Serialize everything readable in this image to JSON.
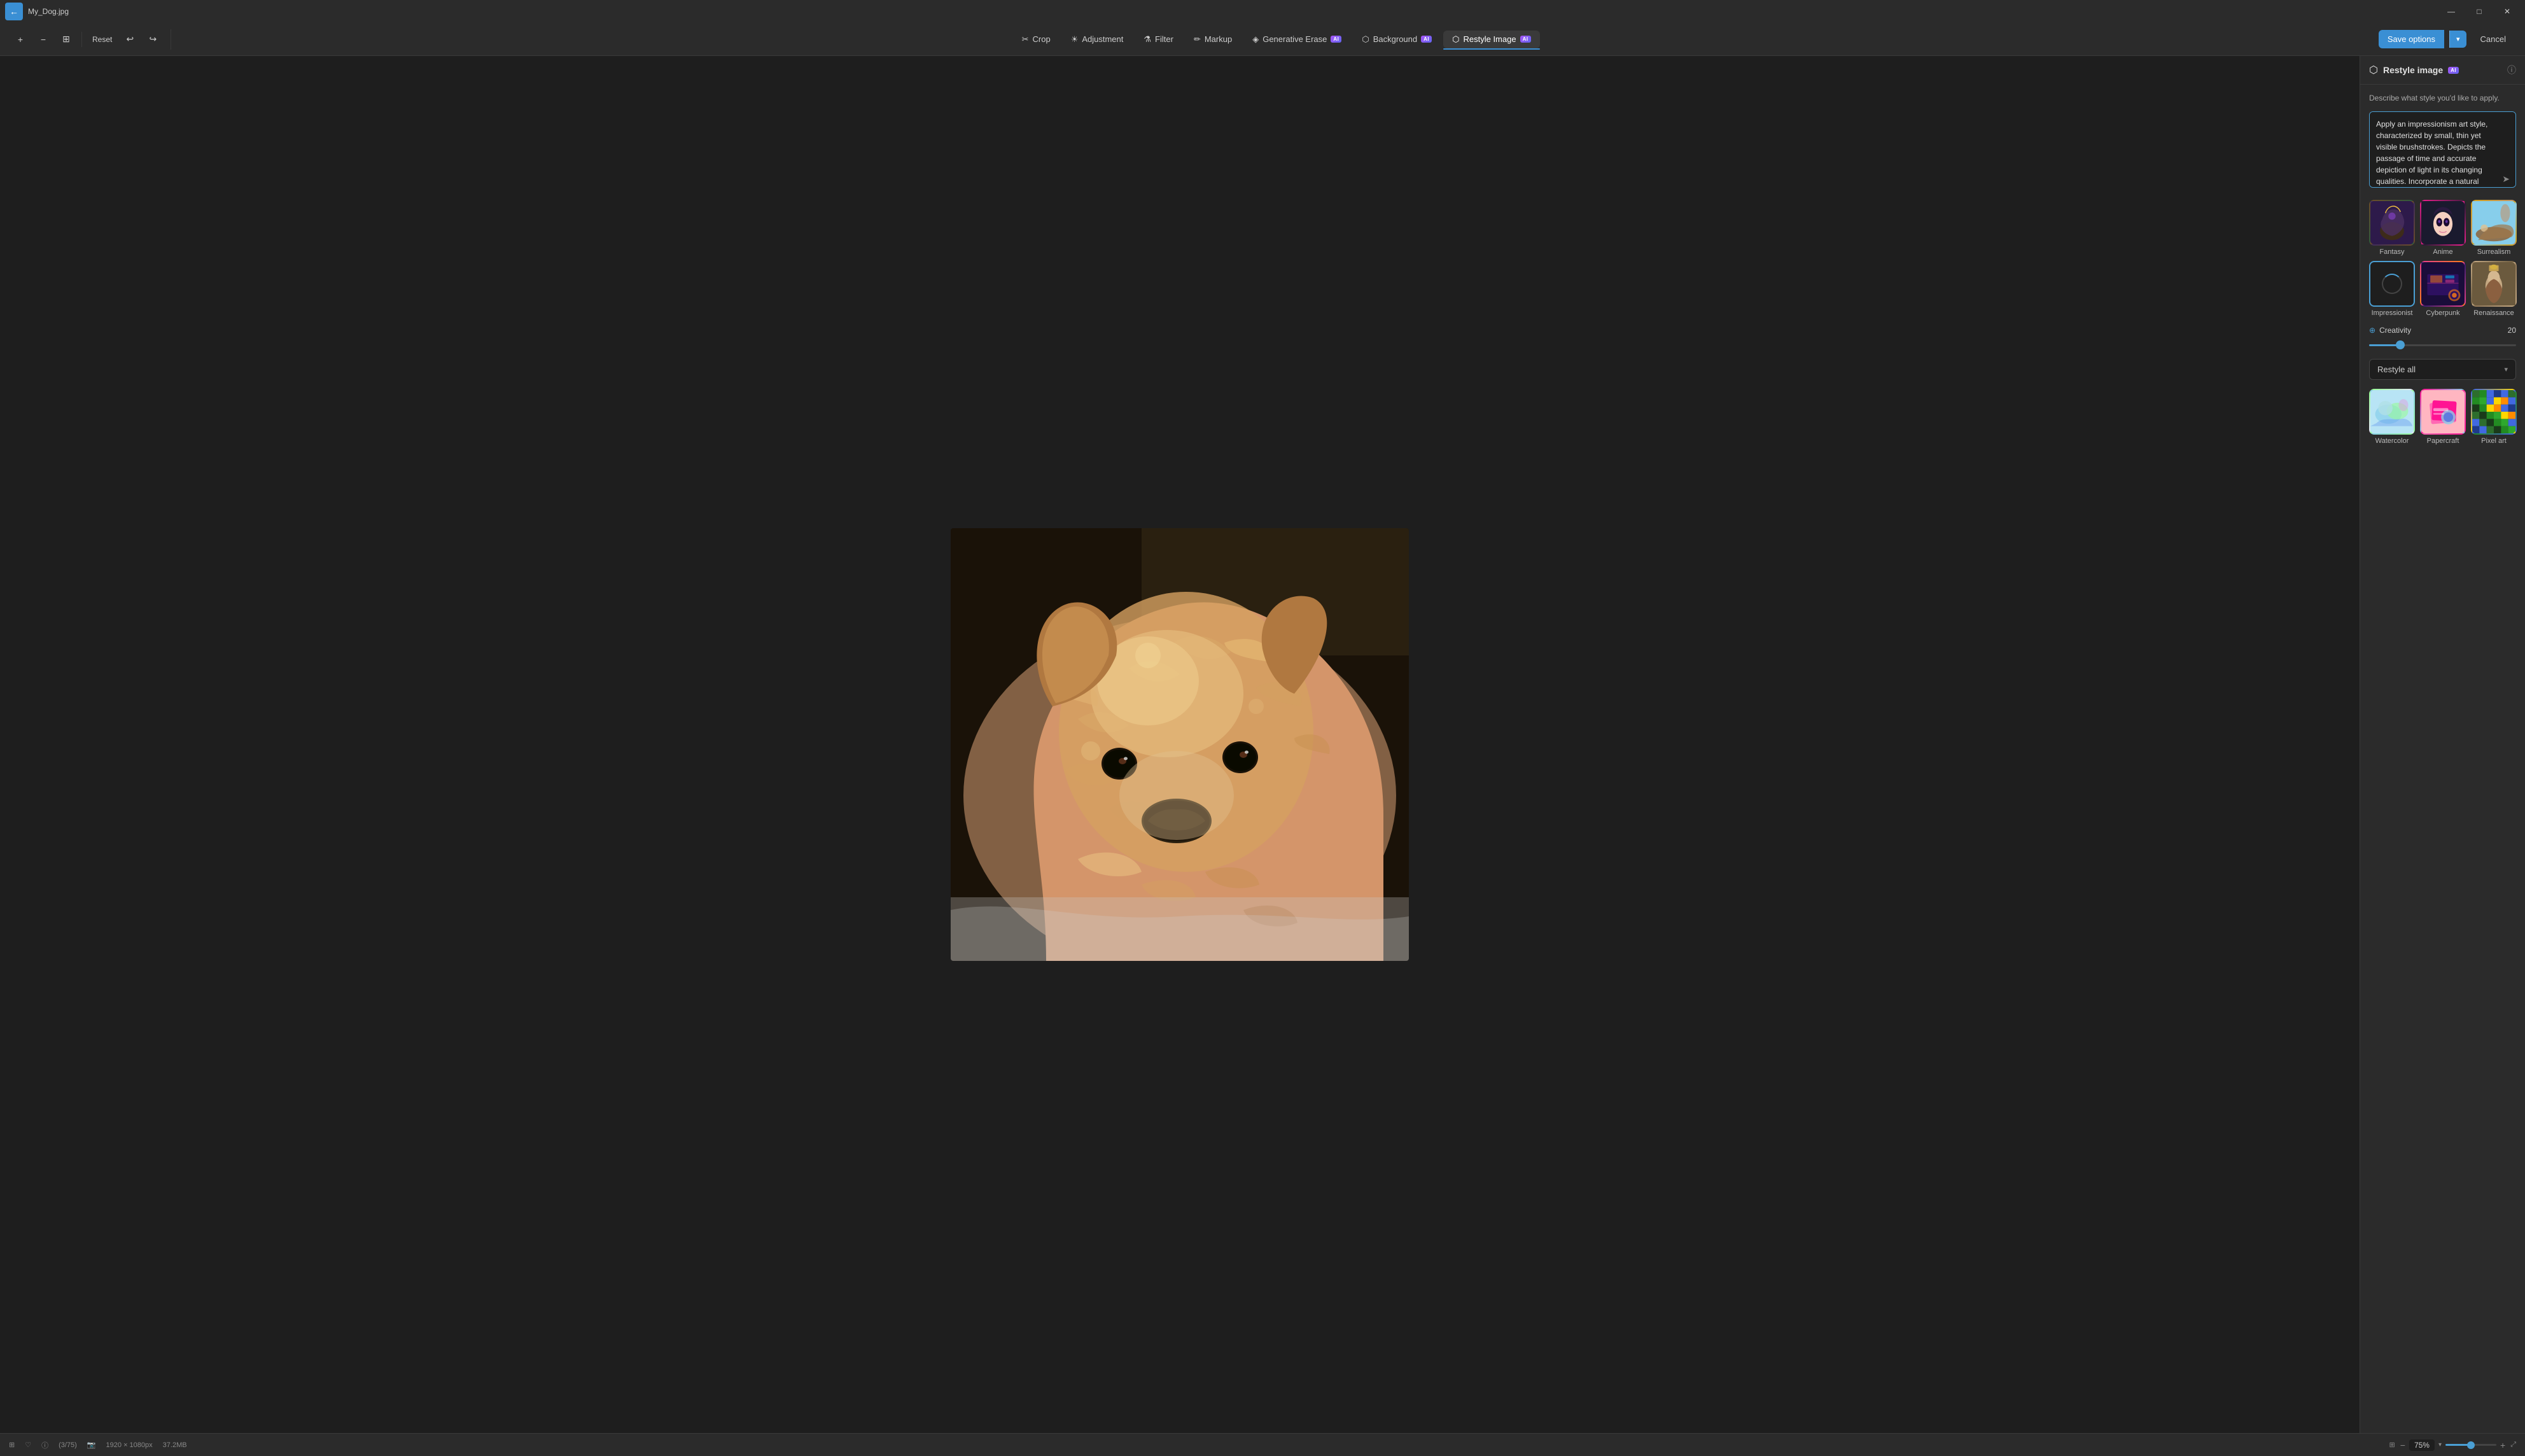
{
  "titlebar": {
    "title": "My_Dog.jpg",
    "back_icon": "←",
    "minimize": "—",
    "maximize": "□",
    "close": "✕"
  },
  "toolbar": {
    "zoom_in": "+",
    "zoom_out": "−",
    "frame": "⊞",
    "reset_label": "Reset",
    "undo": "↩",
    "redo": "↪",
    "tools": [
      {
        "id": "crop",
        "icon": "⊡",
        "label": "Crop",
        "ai": false
      },
      {
        "id": "adjustment",
        "icon": "☀",
        "label": "Adjustment",
        "ai": false
      },
      {
        "id": "filter",
        "icon": "⚗",
        "label": "Filter",
        "ai": false
      },
      {
        "id": "markup",
        "icon": "✏",
        "label": "Markup",
        "ai": false
      },
      {
        "id": "generative-erase",
        "icon": "◈",
        "label": "Generative Erase",
        "ai": true
      },
      {
        "id": "background",
        "icon": "⬡",
        "label": "Background",
        "ai": true
      },
      {
        "id": "restyle-image",
        "icon": "⬡",
        "label": "Restyle Image",
        "ai": true
      }
    ],
    "save_options_label": "Save options",
    "cancel_label": "Cancel"
  },
  "restyle_panel": {
    "title": "Restyle image",
    "ai_badge": "AI",
    "describe_label": "Describe what style you'd like to apply.",
    "textarea_value": "Apply an impressionism art style, characterized by small, thin yet visible brushstrokes. Depicts the passage of time and accurate depiction of light in its changing qualities. Incorporate a natural colour pallete of blues, greens and warm sun or clear night.",
    "send_icon": "➤",
    "styles": [
      {
        "id": "fantasy",
        "label": "Fantasy",
        "class": "thumb-fantasy",
        "selected": false
      },
      {
        "id": "anime",
        "label": "Anime",
        "class": "thumb-anime",
        "selected": false
      },
      {
        "id": "surrealism",
        "label": "Surrealism",
        "class": "thumb-surrealism",
        "selected": false
      },
      {
        "id": "impressionist",
        "label": "Impressionist",
        "class": "thumb-impressionist",
        "selected": true
      },
      {
        "id": "cyberpunk",
        "label": "Cyberpunk",
        "class": "thumb-cyberpunk",
        "selected": false
      },
      {
        "id": "renaissance",
        "label": "Renaissance",
        "class": "thumb-renaissance",
        "selected": false
      }
    ],
    "creativity_label": "Creativity",
    "creativity_value": "20",
    "creativity_percent": 20,
    "restyle_dropdown_label": "Restyle all",
    "bottom_styles": [
      {
        "id": "watercolor",
        "label": "Watercolor",
        "class": "thumb-watercolor"
      },
      {
        "id": "papercraft",
        "label": "Papercraft",
        "class": "thumb-papercraft"
      },
      {
        "id": "pixelart",
        "label": "Pixel art",
        "class": "thumb-pixelart"
      }
    ]
  },
  "statusbar": {
    "grid_icon": "⊞",
    "heart_icon": "♡",
    "info_icon": "ⓘ",
    "image_count": "(3/75)",
    "dimensions": "1920 × 1080px",
    "file_size": "37.2MB",
    "photo_icon": "📷",
    "zoom_out": "−",
    "zoom_value": "75%",
    "zoom_in": "+",
    "expand_icon": "⤢"
  }
}
